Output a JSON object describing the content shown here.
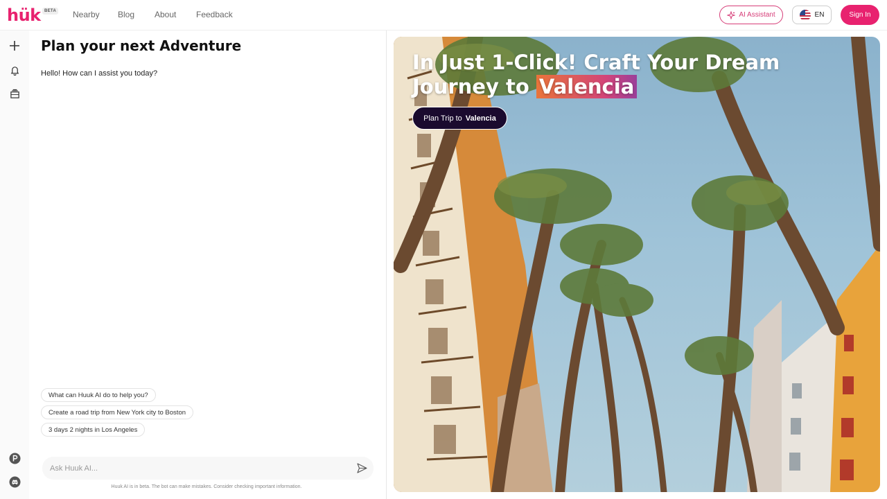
{
  "header": {
    "logo": "hük",
    "badge": "BETA",
    "nav": [
      "Nearby",
      "Blog",
      "About",
      "Feedback"
    ],
    "ai_assistant": "AI Assistant",
    "language": "EN",
    "sign_in": "Sign In"
  },
  "rail": {
    "icons": [
      "plus-icon",
      "bell-icon",
      "inbox-icon",
      "product-hunt-icon",
      "discord-icon"
    ]
  },
  "chat": {
    "title": "Plan your next Adventure",
    "greeting": "Hello! How can I assist you today?",
    "suggestions": [
      "What can Huuk AI do to help you?",
      "Create a road trip from New York city to Boston",
      "3 days 2 nights in Los Angeles"
    ],
    "input_placeholder": "Ask Huuk AI...",
    "disclaimer": "Huuk AI is in beta. The bot can make mistakes. Consider checking important information."
  },
  "hero": {
    "title_part1": "In Just 1-Click! Craft Your Dream Journey to",
    "city": "Valencia",
    "button_prefix": "Plan Trip to",
    "button_city": "Valencia"
  },
  "colors": {
    "brand": "#e8226f",
    "accent_outline": "#d63d78",
    "button_dark": "#1a0a2e"
  }
}
